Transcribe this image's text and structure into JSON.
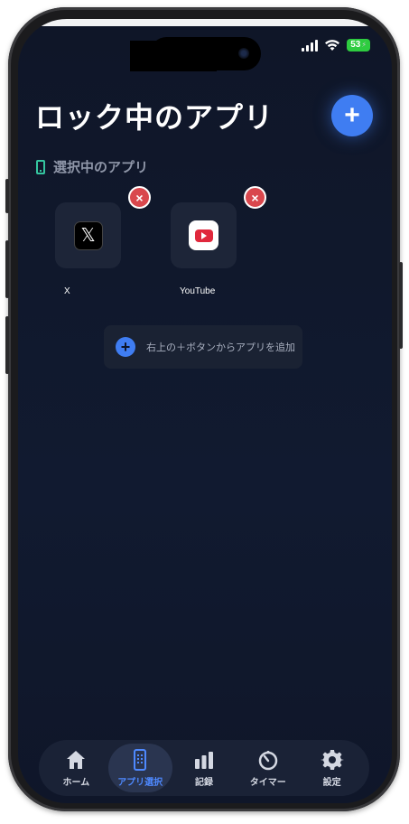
{
  "status": {
    "battery": "53"
  },
  "header": {
    "title": "ロック中のアプリ",
    "add_button": "+"
  },
  "section": {
    "label": "選択中のアプリ"
  },
  "apps": [
    {
      "name": "X",
      "icon": "x-logo",
      "remove": "×"
    },
    {
      "name": "YouTube",
      "icon": "youtube-logo",
      "remove": "×"
    }
  ],
  "hint": {
    "icon": "+",
    "text": "右上の＋ボタンからアプリを追加"
  },
  "tabs": [
    {
      "label": "ホーム",
      "icon": "home-icon"
    },
    {
      "label": "アプリ選択",
      "icon": "phone-icon",
      "active": true
    },
    {
      "label": "記録",
      "icon": "bar-chart-icon"
    },
    {
      "label": "タイマー",
      "icon": "timer-icon"
    },
    {
      "label": "設定",
      "icon": "gear-icon"
    }
  ],
  "colors": {
    "accent": "#3f7df2",
    "background": "#0f1628",
    "danger": "#d9474d",
    "teal": "#35c6a0"
  }
}
